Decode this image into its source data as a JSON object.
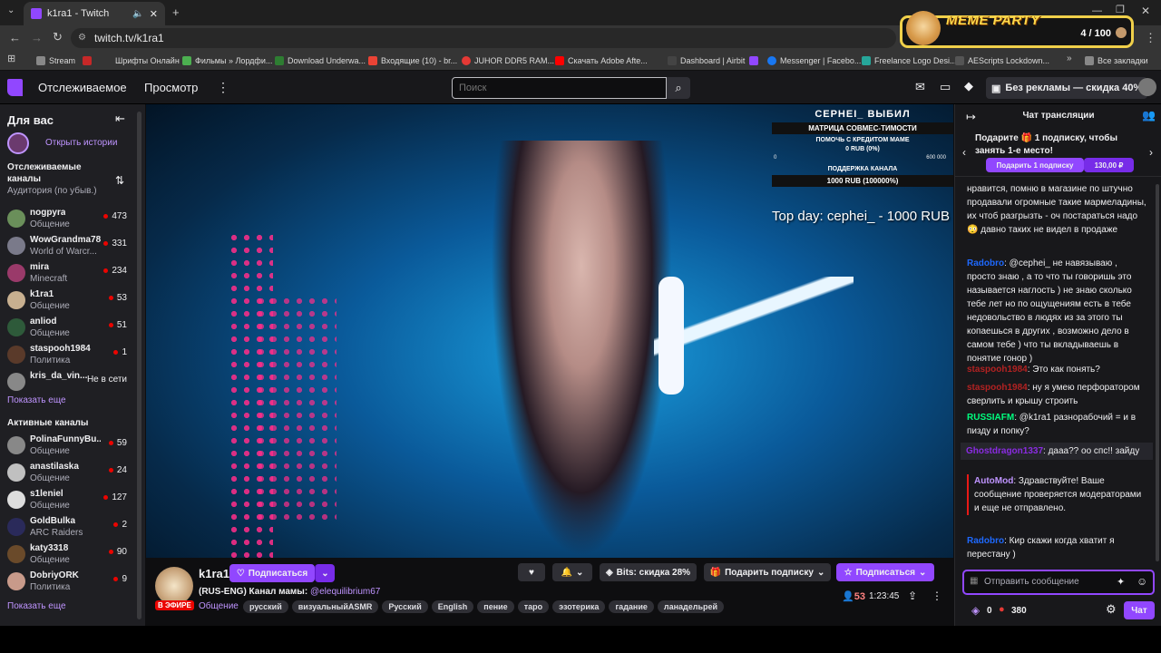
{
  "browser": {
    "tab_title": "k1ra1 - Twitch",
    "url": "twitch.tv/k1ra1",
    "bookmarks": [
      "Stream",
      "Шрифты Онлайн",
      "Фильмы » Лордфи...",
      "Download Underwa...",
      "Входящие (10) - br...",
      "JUHOR DDR5 RAM...",
      "Скачать Adobe Afte...",
      "Dashboard | Airbit",
      "Messenger | Facebo...",
      "Freelance Logo Desi...",
      "AEScripts Lockdown..."
    ],
    "all_bookmarks": "Все закладки"
  },
  "meme_overlay": {
    "title": "MEME PARTY",
    "count": "4 / 100"
  },
  "nav": {
    "following": "Отслеживаемое",
    "browse": "Просмотр",
    "search_placeholder": "Поиск",
    "promo": "Без рекламы — скидка 40%"
  },
  "sidebar": {
    "for_you": "Для вас",
    "open_stories": "Открыть истории",
    "followed_title": "Отслеживаемые каналы",
    "followed_sort": "Аудитория (по убыв.)",
    "followed": [
      {
        "name": "nogpyra",
        "category": "Общение",
        "viewers": "473"
      },
      {
        "name": "WowGrandma78",
        "category": "World of Warcr...",
        "viewers": "331"
      },
      {
        "name": "mira",
        "category": "Minecraft",
        "viewers": "234"
      },
      {
        "name": "k1ra1",
        "category": "Общение",
        "viewers": "53"
      },
      {
        "name": "anliod",
        "category": "Общение",
        "viewers": "51"
      },
      {
        "name": "staspooh1984",
        "category": "Политика",
        "viewers": "1"
      },
      {
        "name": "kris_da_vin...",
        "category": "",
        "viewers": "Не в сети"
      }
    ],
    "show_more": "Показать еще",
    "active_title": "Активные каналы",
    "active": [
      {
        "name": "PolinaFunnyBu...",
        "category": "Общение",
        "viewers": "59"
      },
      {
        "name": "anastilaska",
        "category": "Общение",
        "viewers": "24"
      },
      {
        "name": "s1leniel",
        "category": "Общение",
        "viewers": "127"
      },
      {
        "name": "GoldBulka",
        "category": "ARC Raiders",
        "viewers": "2"
      },
      {
        "name": "katy3318",
        "category": "Общение",
        "viewers": "90"
      },
      {
        "name": "DobriyORK",
        "category": "Политика",
        "viewers": "9"
      }
    ],
    "show_more_2": "Показать еще"
  },
  "video": {
    "overlay_title": "CEPHEI_ ВЫБИЛ",
    "overlay_sub": "МАТРИЦА СОВМЕС-ТИМОСТИ",
    "overlay_line1": "ПОМОЧЬ С КРЕДИТОМ МАМЕ",
    "overlay_line2": "0 RUB (0%)",
    "overlay_min": "0",
    "overlay_max": "600 000",
    "overlay_line3": "ПОДДЕРЖКА КАНАЛА",
    "overlay_line4": "1000 RUB (100000%)",
    "top_day": "Top day: cephei_ - 1000 RUB"
  },
  "channel": {
    "name": "k1ra1",
    "follow": "Подписаться",
    "live": "В ЭФИРЕ",
    "title": "(RUS-ENG) Канал мамы: ",
    "mention": "@elequilibrium67",
    "category": "Общение",
    "tags": [
      "русский",
      "визуальныйASMR",
      "Русский",
      "English",
      "пение",
      "таро",
      "эзотерика",
      "гадание",
      "ланадельрей"
    ],
    "bits": "Bits: скидка 28%",
    "gift_sub": "Подарить подписку",
    "subscribe": "Подписаться",
    "viewers": "53",
    "uptime": "1:23:45"
  },
  "chat": {
    "title": "Чат трансляции",
    "gift_prompt": "Подарите 🎁 1 подписку, чтобы занять 1-е место!",
    "gift_button": "Подарить 1 подписку",
    "gift_price": "130,00 ₽",
    "messages": [
      {
        "user": "",
        "text": "нравится, помню в магазине по штучно продавали огромные такие мармеладины, их чтоб разгрызть - оч постараться надо 😳 давно таких не видел в продаже",
        "color": "#efeff1"
      },
      {
        "user": "Radobro",
        "text": ": @cephei_ не навязываю , просто знаю , а то что ты говоришь это называется наглость ) не знаю сколько тебе лет но по ощущениям есть в тебе недовольство в людях из за этого ты копаешься в других , возможно дело в самом тебе ) что ты вкладываешь в понятие гонор )",
        "color": "#1e69ff"
      },
      {
        "user": "staspooh1984",
        "text": ": Это как понять?",
        "color": "#b22222"
      },
      {
        "user": "staspooh1984",
        "text": ": ну я умею перфоратором сверлить и крышу строить",
        "color": "#b22222"
      },
      {
        "user": "RUSSIAFM",
        "text": ": @k1ra1 разнорабочий = и в пизду и попку?",
        "color": "#00ff7f"
      },
      {
        "user": "Ghostdragon1337",
        "text": ": дааа?? оо спс!! зайду",
        "color": "#8a2be2"
      },
      {
        "user": "AutoMod",
        "text": ": Здравствуйте! Ваше сообщение проверяется модераторами и еще не отправлено.",
        "color": "#bf94ff"
      },
      {
        "user": "Radobro",
        "text": ": Кир скажи когда хватит я перестану )",
        "color": "#1e69ff"
      }
    ],
    "input_placeholder": "Отправить сообщение",
    "bits_count": "0",
    "points": "380",
    "chat_button": "Чат"
  },
  "colors": {
    "accent": "#9147ff",
    "live": "#eb0400",
    "link": "#bf94ff"
  }
}
